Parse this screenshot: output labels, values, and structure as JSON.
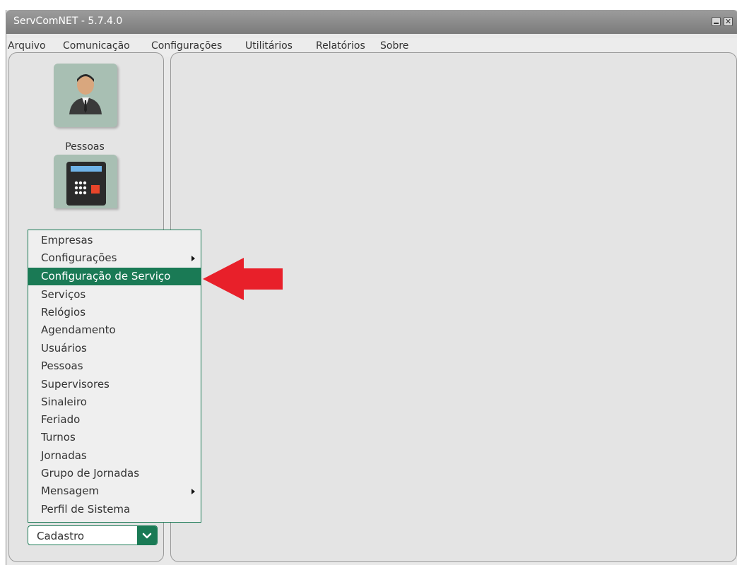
{
  "window": {
    "title": "ServComNET - 5.7.4.0"
  },
  "menubar": {
    "items": [
      "Arquivo",
      "Comunicação",
      "Configurações",
      "Utilitários",
      "Relatórios",
      "Sobre"
    ]
  },
  "sidebar": {
    "tiles": [
      {
        "label": "Pessoas",
        "icon": "person-icon"
      },
      {
        "label": "",
        "icon": "time-clock-icon"
      }
    ]
  },
  "popup_menu": {
    "items": [
      {
        "label": "Empresas",
        "submenu": false
      },
      {
        "label": "Configurações",
        "submenu": true
      },
      {
        "label": "Configuração de Serviço",
        "submenu": false,
        "selected": true
      },
      {
        "label": "Serviços",
        "submenu": false
      },
      {
        "label": "Relógios",
        "submenu": false
      },
      {
        "label": "Agendamento",
        "submenu": false
      },
      {
        "label": "Usuários",
        "submenu": false
      },
      {
        "label": "Pessoas",
        "submenu": false
      },
      {
        "label": "Supervisores",
        "submenu": false
      },
      {
        "label": "Sinaleiro",
        "submenu": false
      },
      {
        "label": "Feriado",
        "submenu": false
      },
      {
        "label": "Turnos",
        "submenu": false
      },
      {
        "label": "Jornadas",
        "submenu": false
      },
      {
        "label": "Grupo de Jornadas",
        "submenu": false
      },
      {
        "label": "Mensagem",
        "submenu": true
      },
      {
        "label": "Perfil de Sistema",
        "submenu": false
      }
    ]
  },
  "combo": {
    "value": "Cadastro"
  },
  "colors": {
    "accent": "#1a7a55",
    "annotation_arrow": "#e8202a",
    "titlebar": "#8c8c8c"
  }
}
